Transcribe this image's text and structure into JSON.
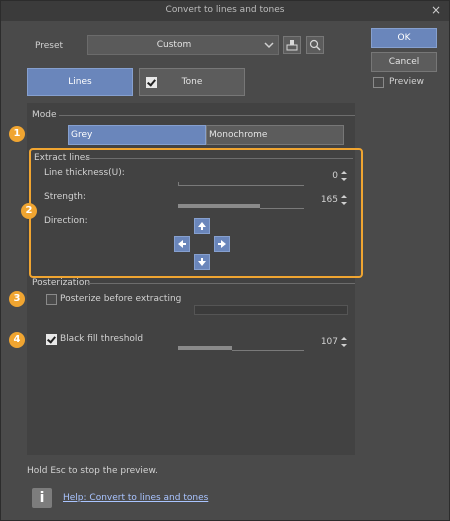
{
  "window": {
    "title": "Convert to lines and tones",
    "close_glyph": "×"
  },
  "preset": {
    "label": "Preset",
    "value": "Custom"
  },
  "tabs": {
    "lines": "Lines",
    "tone": "Tone"
  },
  "buttons": {
    "ok": "OK",
    "cancel": "Cancel",
    "preview": "Preview"
  },
  "mode": {
    "label": "Mode",
    "options": [
      "Grey",
      "Monochrome"
    ],
    "selected": "Grey"
  },
  "extract_lines": {
    "label": "Extract lines",
    "line_thickness_label": "Line thickness(U):",
    "line_thickness_value": "0",
    "strength_label": "Strength:",
    "strength_value": "165",
    "direction_label": "Direction:"
  },
  "posterization": {
    "label": "Posterization",
    "posterize_label": "Posterize before extracting"
  },
  "black_fill": {
    "label": "Black fill threshold",
    "value": "107"
  },
  "footer": {
    "hint": "Hold Esc to stop the preview.",
    "help_link": "Help: Convert to lines and tones",
    "info_glyph": "i"
  },
  "annotations": [
    "1",
    "2",
    "3",
    "4"
  ],
  "colors": {
    "accent": "#6a86bb",
    "highlight": "#f0a531",
    "window_bg": "#4a4a4a"
  },
  "icons": [
    "dropdown-arrow-icon",
    "save-preset-icon",
    "search-preset-icon",
    "arrow-up-icon",
    "arrow-left-icon",
    "arrow-right-icon",
    "arrow-down-icon",
    "info-icon"
  ]
}
